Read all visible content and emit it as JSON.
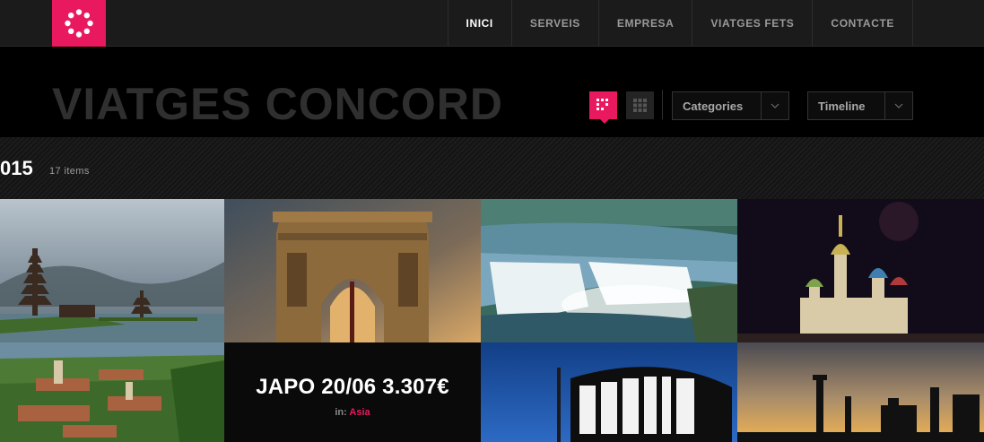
{
  "nav": {
    "items": [
      {
        "label": "INICI",
        "active": true
      },
      {
        "label": "SERVEIS",
        "active": false
      },
      {
        "label": "EMPRESA",
        "active": false
      },
      {
        "label": "VIATGES FETS",
        "active": false
      },
      {
        "label": "CONTACTE",
        "active": false
      }
    ]
  },
  "header": {
    "title": "VIATGES CONCORD",
    "filters": {
      "categories_label": "Categories",
      "timeline_label": "Timeline"
    }
  },
  "timeline": {
    "year": "015",
    "count": "17 items"
  },
  "gallery": {
    "featured": {
      "title": "JAPO 20/06 3.307€",
      "category_prefix": "in:",
      "category": "Asia"
    },
    "tiles": [
      {
        "image": "bali-temple-lake"
      },
      {
        "image": "triumphal-arch"
      },
      {
        "image": "waterfalls"
      },
      {
        "image": "onion-dome-cathedral-night"
      },
      {
        "image": "old-town-aerial"
      },
      {
        "image": "japan-featured"
      },
      {
        "image": "berlin-sign"
      },
      {
        "image": "ruins-sunset"
      }
    ]
  },
  "colors": {
    "accent": "#e8195f",
    "nav_bg": "#1b1b1b",
    "title_text": "#2f2f2f"
  }
}
